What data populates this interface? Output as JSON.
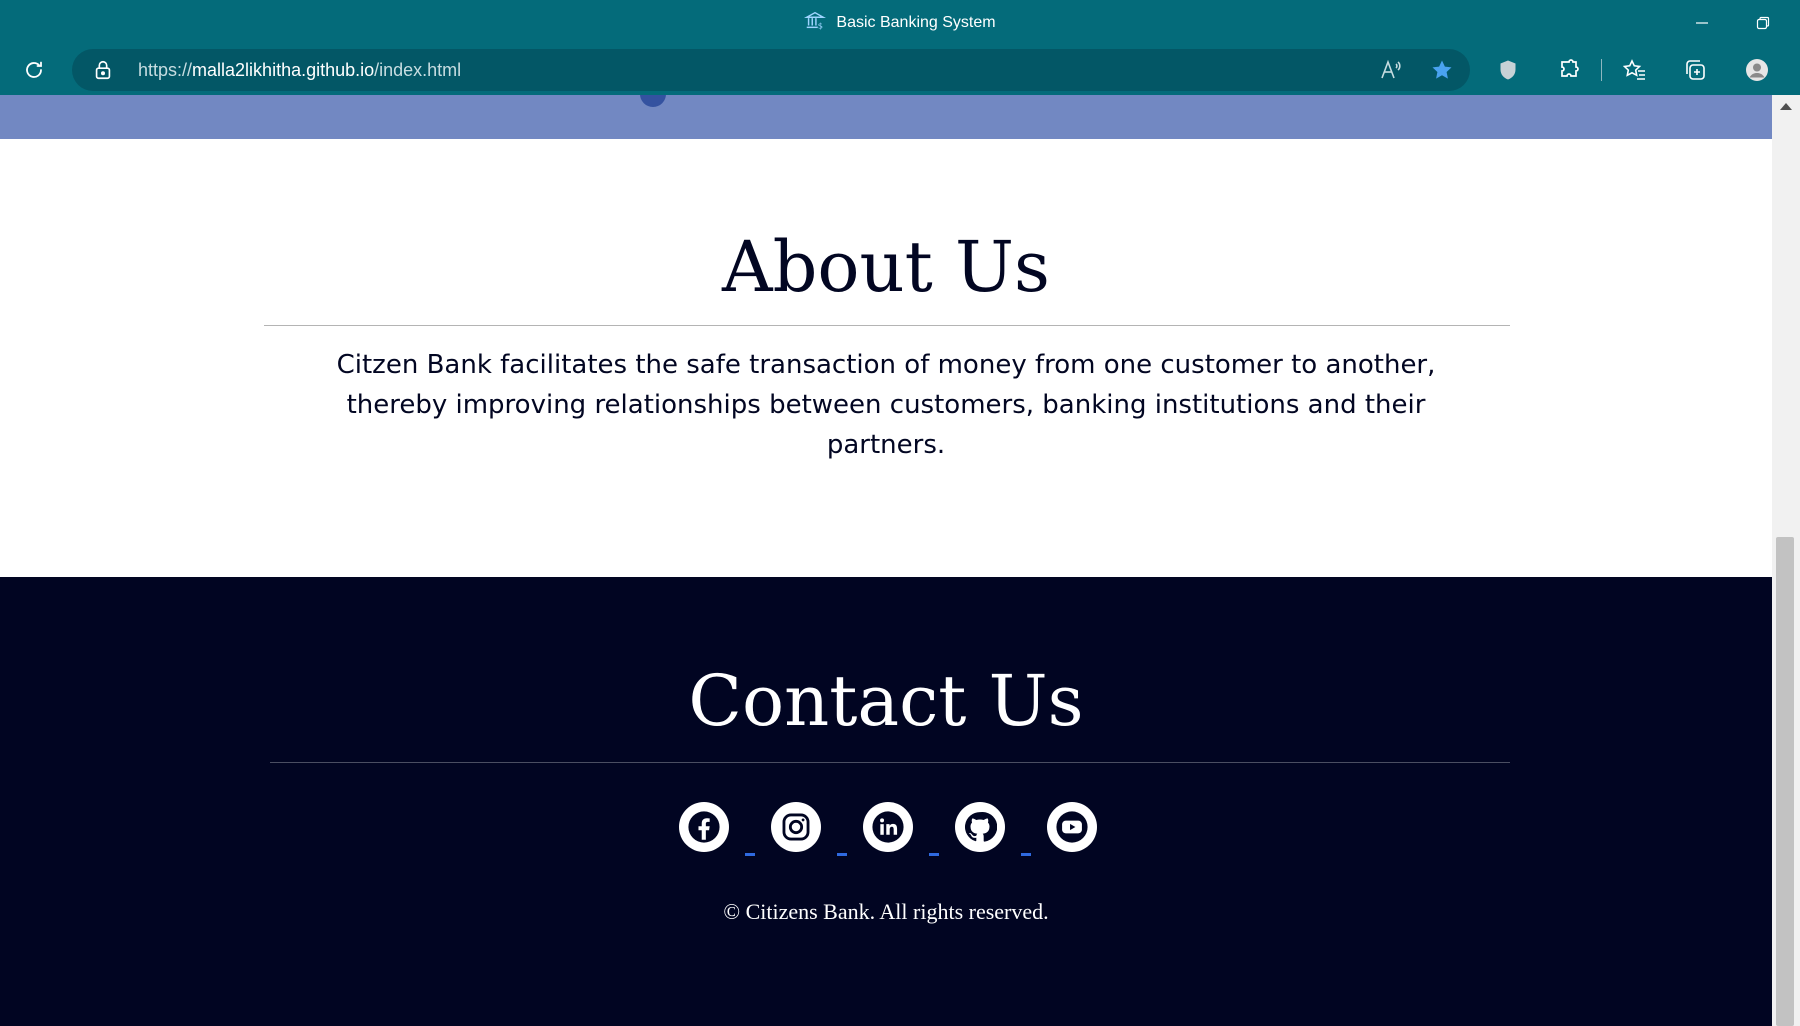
{
  "window": {
    "title": "Basic Banking System"
  },
  "address_bar": {
    "url_prefix": "https://",
    "url_domain": "malla2likhitha.github.io",
    "url_path": "/index.html"
  },
  "about": {
    "heading": "About Us",
    "text": "Citzen Bank facilitates the safe transaction of money from one customer to another, thereby improving relationships between customers, banking institutions and their partners."
  },
  "contact": {
    "heading": "Contact Us",
    "socials": [
      "facebook-icon",
      "instagram-icon",
      "linkedin-icon",
      "github-icon",
      "youtube-icon"
    ],
    "copyright": "© Citizens Bank. All rights reserved."
  },
  "colors": {
    "browser_teal": "#046b7a",
    "hero_strip": "#7288c2",
    "footer_bg": "#010522",
    "text_dark": "#020622"
  }
}
